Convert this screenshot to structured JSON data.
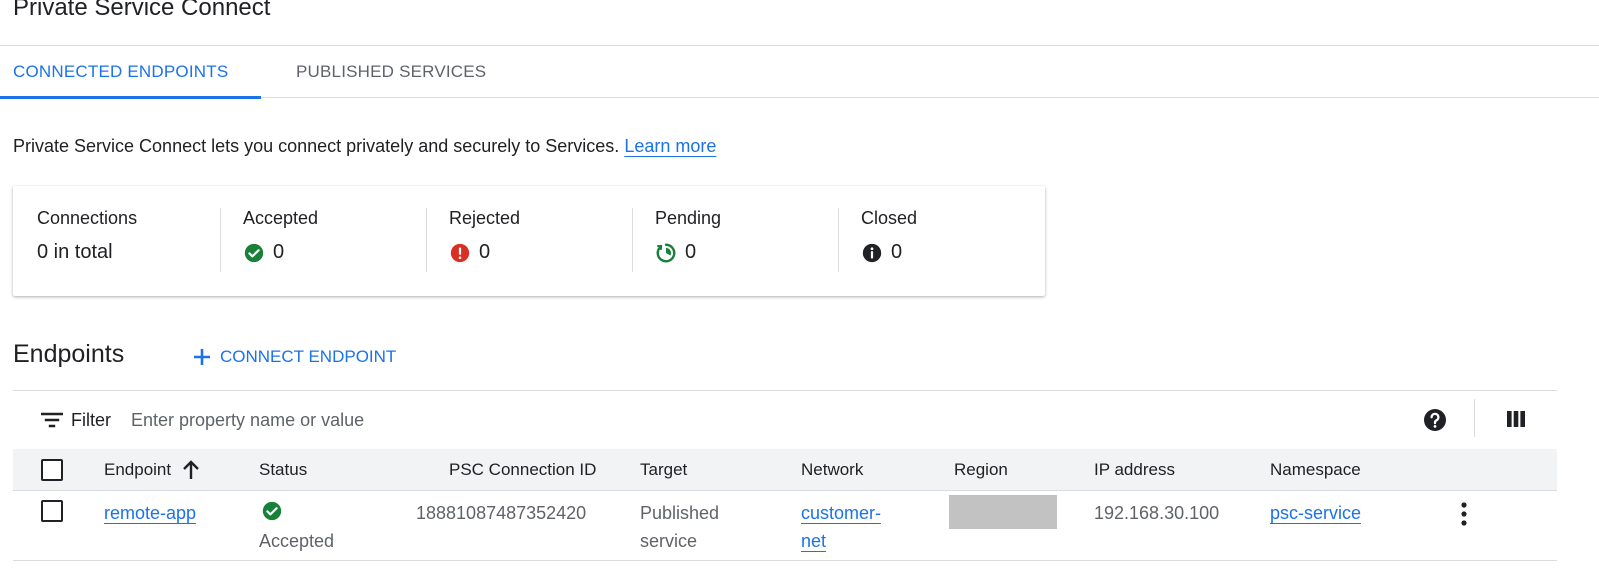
{
  "page": {
    "title": "Private Service Connect"
  },
  "tabs": [
    {
      "label": "CONNECTED ENDPOINTS",
      "active": true
    },
    {
      "label": "PUBLISHED SERVICES",
      "active": false
    }
  ],
  "intro": {
    "text": "Private Service Connect lets you connect privately and securely to Services.",
    "link_label": "Learn more"
  },
  "summary": {
    "connections": {
      "label": "Connections",
      "value": "0 in total"
    },
    "accepted": {
      "label": "Accepted",
      "value": "0",
      "icon": "check-circle-icon",
      "color": "#188038"
    },
    "rejected": {
      "label": "Rejected",
      "value": "0",
      "icon": "error-icon",
      "color": "#d93025"
    },
    "pending": {
      "label": "Pending",
      "value": "0",
      "icon": "pending-icon",
      "color": "#188038"
    },
    "closed": {
      "label": "Closed",
      "value": "0",
      "icon": "info-icon",
      "color": "#202124"
    }
  },
  "endpoints": {
    "title": "Endpoints",
    "connect_button_label": "CONNECT ENDPOINT",
    "filter": {
      "label": "Filter",
      "placeholder": "Enter property name or value"
    },
    "columns": {
      "endpoint": "Endpoint",
      "status": "Status",
      "psc_connection_id": "PSC Connection ID",
      "target": "Target",
      "network": "Network",
      "region": "Region",
      "ip_address": "IP address",
      "namespace": "Namespace"
    },
    "sort": {
      "column": "endpoint",
      "direction": "ascending"
    },
    "rows": [
      {
        "endpoint": "remote-app",
        "status": "Accepted",
        "psc_connection_id": "18881087487352420",
        "target_line1": "Published",
        "target_line2": "service",
        "network_line1": "customer-",
        "network_line2": "net",
        "region": "",
        "ip_address": "192.168.30.100",
        "namespace": "psc-service"
      }
    ]
  },
  "colors": {
    "accent": "#1a73e8",
    "success": "#188038",
    "error": "#d93025",
    "header_bg": "#f1f3f4",
    "redacted": "#c2c2c2"
  }
}
